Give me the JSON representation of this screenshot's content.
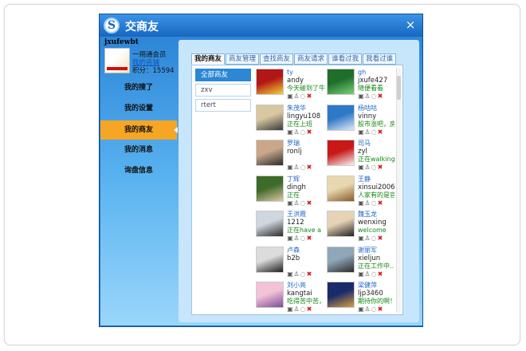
{
  "window": {
    "title": "交商友",
    "logo": "S",
    "close": "×"
  },
  "profile": {
    "username": "jxufewbt",
    "level": "一朔通会员",
    "shop_link": "我的商铺",
    "points": "积分：15594"
  },
  "nav": [
    "我的搜了",
    "我的设置",
    "我的商友",
    "我的消息",
    "询盘信息"
  ],
  "tabs": [
    "我的商友",
    "商友管理",
    "查找商友",
    "商友请求",
    "谁看过我",
    "我看过谁"
  ],
  "groups": [
    "全部商友",
    "zxv",
    "rtert"
  ],
  "friends": [
    {
      "cn": "ty",
      "id": "andy",
      "status": "今天碰到了牛",
      "photo": [
        "#b31616",
        "#f2d23a"
      ]
    },
    {
      "cn": "gh",
      "id": "jxufe427",
      "status": "随便看看",
      "photo": [
        "#1f6f2b",
        "#7ad07a"
      ]
    },
    {
      "cn": "朱茂华",
      "id": "lingyu108",
      "status": "正在上班",
      "photo": [
        "#d8c7a0",
        "#3a3a3a"
      ]
    },
    {
      "cn": "杨咕咕",
      "id": "vinny",
      "status": "股市涨吧，房",
      "photo": [
        "#2e78c8",
        "#dfe9f2"
      ]
    },
    {
      "cn": "罗瑞",
      "id": "ronlj",
      "status": "",
      "photo": [
        "#c9a88a",
        "#2a2a2a"
      ]
    },
    {
      "cn": "司马",
      "id": "zyl",
      "status": "正在walking",
      "photo": [
        "#c81818",
        "#f4f4f4"
      ]
    },
    {
      "cn": "丁辉",
      "id": "dingh",
      "status": "正在",
      "photo": [
        "#3d6b2a",
        "#e0c6a6"
      ]
    },
    {
      "cn": "王静",
      "id": "xinsui2006",
      "status": "人家有的是官",
      "photo": [
        "#e8d8b0",
        "#8a5a2a"
      ]
    },
    {
      "cn": "王洪霞",
      "id": "1212",
      "status": "正在have a",
      "photo": [
        "#cfd6de",
        "#2b2b2b"
      ]
    },
    {
      "cn": "魏玉龙",
      "id": "wenxing",
      "status": "welcome",
      "photo": [
        "#e6d3b5",
        "#222222"
      ]
    },
    {
      "cn": "卢森",
      "id": "b2b",
      "status": "",
      "photo": [
        "#dcdcdc",
        "#1e1e1e"
      ]
    },
    {
      "cn": "谢丽军",
      "id": "xieljun",
      "status": "正在工作中…",
      "photo": [
        "#8fa7b8",
        "#2c2c2c"
      ]
    },
    {
      "cn": "刘小亮",
      "id": "kangtai",
      "status": "吃得苦中苦，",
      "photo": [
        "#f2c2d6",
        "#7a4a9a"
      ]
    },
    {
      "cn": "梁健萍",
      "id": "ljp3460",
      "status": "期待你的啊！",
      "photo": [
        "#1a2a6a",
        "#d8a040"
      ]
    }
  ],
  "action_icons": [
    "save-icon",
    "lock-icon",
    "chat-icon",
    "delete-icon"
  ],
  "action_glyphs": [
    "▣",
    "♙",
    "◌",
    "✖"
  ]
}
